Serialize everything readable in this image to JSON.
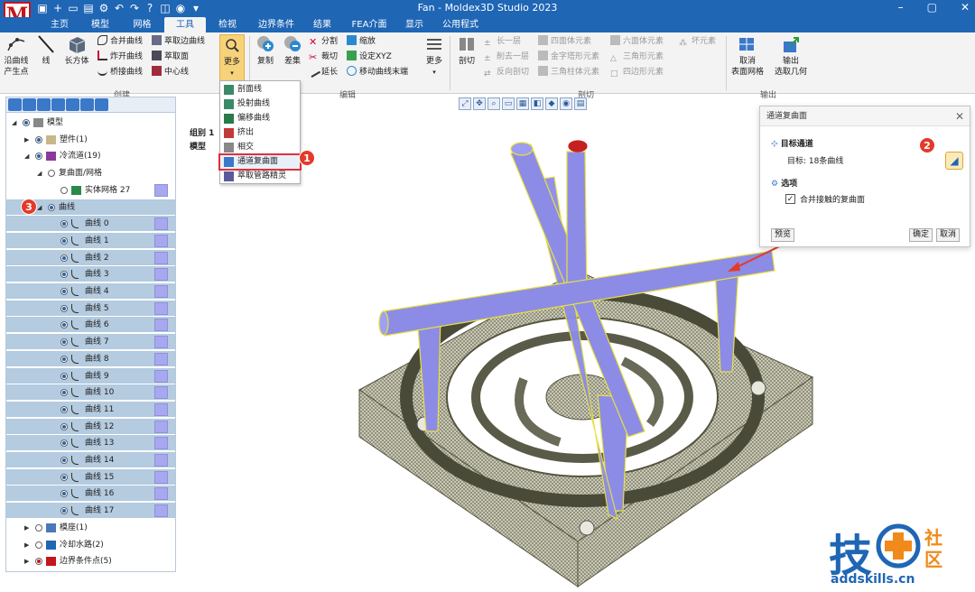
{
  "app": {
    "logo": "M",
    "window_title": "Fan - Moldex3D Studio 2023"
  },
  "tabs": [
    "主页",
    "模型",
    "网格",
    "工具",
    "检视",
    "边界条件",
    "结果",
    "FEA介面",
    "显示",
    "公用程式"
  ],
  "active_tab": "工具",
  "ribbon": {
    "groups": {
      "create": "创建",
      "edit": "编辑",
      "cut": "剖切",
      "output": "输出"
    },
    "along_curve": "沿曲线\n产生点",
    "line": "线",
    "cuboid": "长方体",
    "merge_curves": "合并曲线",
    "break_curves": "炸开曲线",
    "bridge_curves": "桥接曲线",
    "extract_edge_curves": "萃取边曲线",
    "extract_surface": "萃取面",
    "center_line": "中心线",
    "more": "更多",
    "copy": "复制",
    "difference": "差集",
    "split": "分割",
    "trim": "裁切",
    "extend": "延长",
    "scale": "缩放",
    "set_xyz": "设定XYZ",
    "move_curve_end": "移动曲线末端",
    "more2": "更多",
    "section": "剖切",
    "layer_long": "长一层",
    "layer_cut": "削去一层",
    "reverse_section": "反向剖切",
    "tetra_elements": "四面体元素",
    "pyramid_elements": "金字塔形元素",
    "prism_elements": "三角柱体元素",
    "hexa_elements": "六面体元素",
    "triangle": "三角形元素",
    "quad": "四边形元素",
    "bad_elements": "坏元素",
    "cancel_surface_mesh": "取消\n表面网格",
    "export_extract_geometry": "输出\n选取几何"
  },
  "more_menu": {
    "items": [
      "剖面线",
      "投射曲线",
      "偏移曲线",
      "挤出",
      "相交",
      "通道复曲面",
      "萃取管路精灵"
    ],
    "highlighted": "通道复曲面"
  },
  "viewport": {
    "label_group": "组别 1",
    "label_model": "模型"
  },
  "tree": {
    "rows": [
      {
        "label": "模型",
        "level": 0,
        "arrow": "◢",
        "radio": "on",
        "icon": "model"
      },
      {
        "label": "塑件(1)",
        "level": 1,
        "arrow": "▶",
        "radio": "on",
        "icon": "part"
      },
      {
        "label": "冷流道(19)",
        "level": 1,
        "arrow": "◢",
        "radio": "on",
        "icon": "runner"
      },
      {
        "label": "复曲面/网格",
        "level": 2,
        "arrow": "◢",
        "radio": "off",
        "icon": ""
      },
      {
        "label": "实体网格 27",
        "level": 3,
        "arrow": "",
        "radio": "off",
        "icon": "mesh",
        "swatch": true
      },
      {
        "label": "曲线",
        "level": 2,
        "arrow": "◢",
        "radio": "on",
        "icon": "",
        "sel": true
      },
      {
        "label": "曲线 0",
        "level": 3,
        "arrow": "",
        "radio": "on",
        "icon": "curve",
        "swatch": true,
        "sel": true
      },
      {
        "label": "曲线 1",
        "level": 3,
        "arrow": "",
        "radio": "on",
        "icon": "curve",
        "swatch": true,
        "sel": true
      },
      {
        "label": "曲线 2",
        "level": 3,
        "arrow": "",
        "radio": "on",
        "icon": "curve",
        "swatch": true,
        "sel": true
      },
      {
        "label": "曲线 3",
        "level": 3,
        "arrow": "",
        "radio": "on",
        "icon": "curve",
        "swatch": true,
        "sel": true
      },
      {
        "label": "曲线 4",
        "level": 3,
        "arrow": "",
        "radio": "on",
        "icon": "curve",
        "swatch": true,
        "sel": true
      },
      {
        "label": "曲线 5",
        "level": 3,
        "arrow": "",
        "radio": "on",
        "icon": "curve",
        "swatch": true,
        "sel": true
      },
      {
        "label": "曲线 6",
        "level": 3,
        "arrow": "",
        "radio": "on",
        "icon": "curve",
        "swatch": true,
        "sel": true
      },
      {
        "label": "曲线 7",
        "level": 3,
        "arrow": "",
        "radio": "on",
        "icon": "curve",
        "swatch": true,
        "sel": true
      },
      {
        "label": "曲线 8",
        "level": 3,
        "arrow": "",
        "radio": "on",
        "icon": "curve",
        "swatch": true,
        "sel": true
      },
      {
        "label": "曲线 9",
        "level": 3,
        "arrow": "",
        "radio": "on",
        "icon": "curve",
        "swatch": true,
        "sel": true
      },
      {
        "label": "曲线 10",
        "level": 3,
        "arrow": "",
        "radio": "on",
        "icon": "curve",
        "swatch": true,
        "sel": true
      },
      {
        "label": "曲线 11",
        "level": 3,
        "arrow": "",
        "radio": "on",
        "icon": "curve",
        "swatch": true,
        "sel": true
      },
      {
        "label": "曲线 12",
        "level": 3,
        "arrow": "",
        "radio": "on",
        "icon": "curve",
        "swatch": true,
        "sel": true
      },
      {
        "label": "曲线 13",
        "level": 3,
        "arrow": "",
        "radio": "on",
        "icon": "curve",
        "swatch": true,
        "sel": true
      },
      {
        "label": "曲线 14",
        "level": 3,
        "arrow": "",
        "radio": "on",
        "icon": "curve",
        "swatch": true,
        "sel": true
      },
      {
        "label": "曲线 15",
        "level": 3,
        "arrow": "",
        "radio": "on",
        "icon": "curve",
        "swatch": true,
        "sel": true
      },
      {
        "label": "曲线 16",
        "level": 3,
        "arrow": "",
        "radio": "on",
        "icon": "curve",
        "swatch": true,
        "sel": true
      },
      {
        "label": "曲线 17",
        "level": 3,
        "arrow": "",
        "radio": "on",
        "icon": "curve",
        "swatch": true,
        "sel": true
      },
      {
        "label": "模座(1)",
        "level": 1,
        "arrow": "▶",
        "radio": "off",
        "icon": "base"
      },
      {
        "label": "冷却水路(2)",
        "level": 1,
        "arrow": "▶",
        "radio": "off",
        "icon": "cool"
      },
      {
        "label": "边界条件点(5)",
        "level": 1,
        "arrow": "▶",
        "radio": "on",
        "icon": "bc"
      }
    ]
  },
  "dialog": {
    "title": "通道复曲面",
    "section_target": "目标通道",
    "target_label": "目标:",
    "target_value": "18条曲线",
    "section_options": "选项",
    "merge_checkbox": "合并接触的复曲面",
    "merge_checked": true,
    "preview": "预览",
    "ok": "确定",
    "cancel": "取消"
  },
  "callouts": [
    "1",
    "2",
    "3"
  ],
  "watermark": {
    "main": "技",
    "sub1": "社",
    "sub2": "区",
    "url": "addskills.cn"
  },
  "colors": {
    "titlebar": "#1f66b5",
    "accent": "#e43a2a",
    "selection": "#b4cbe0",
    "pipe": "#8c8ce6",
    "pipe_edge": "#e8e040",
    "mesh": "#8a8a6a"
  }
}
